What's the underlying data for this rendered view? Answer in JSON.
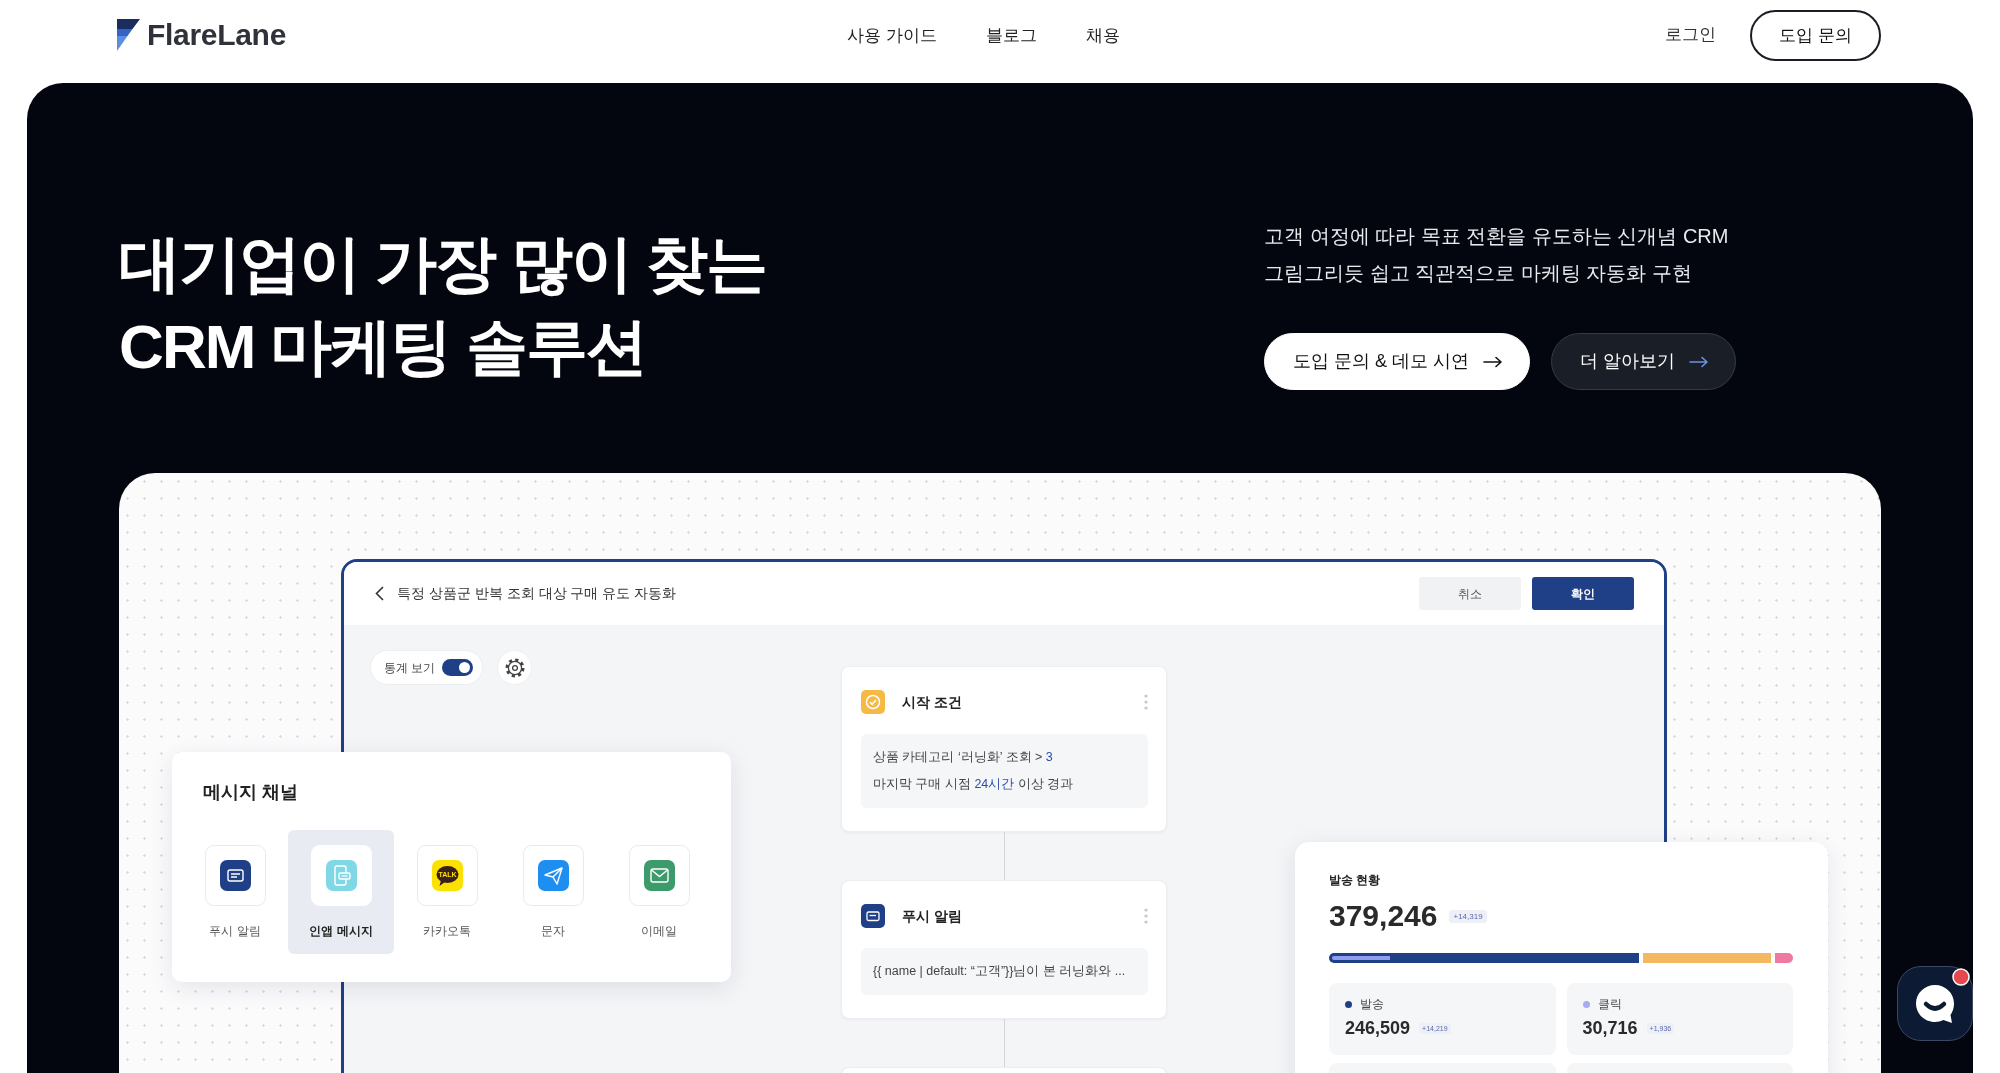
{
  "header": {
    "logo": "FlareLane",
    "nav": [
      "사용 가이드",
      "블로그",
      "채용"
    ],
    "login": "로그인",
    "cta": "도입 문의"
  },
  "hero": {
    "headline": [
      "대기업이 가장 많이 찾는",
      "CRM 마케팅 솔루션"
    ],
    "description": [
      "고객 여정에 따라 목표 전환을 유도하는 신개념 CRM",
      "그림그리듯 쉽고 직관적으로 마케팅 자동화 구현"
    ],
    "buttons": [
      {
        "label": "도입 문의 & 데모 시연",
        "kind": "primary"
      },
      {
        "label": "더 알아보기",
        "kind": "secondary"
      }
    ]
  },
  "editor": {
    "title": "특정 상품군 반복 조회 대상 구매 유도 자동화",
    "actions": [
      {
        "label": "취소",
        "kind": "secondary"
      },
      {
        "label": "확인",
        "kind": "primary"
      }
    ],
    "stats_toggle": {
      "label": "통계 보기",
      "on": true
    },
    "nodes": [
      {
        "kind": "trigger",
        "title": "시작 조건",
        "lines": [
          [
            {
              "text": "상품 카테고리 ‘러닝화’ 조회 > ",
              "highlight": false
            },
            {
              "text": "3",
              "highlight": true
            }
          ],
          [
            {
              "text": "마지막 구매 시점 ",
              "highlight": false
            },
            {
              "text": "24시간",
              "highlight": true
            },
            {
              "text": " 이상 경과",
              "highlight": false
            }
          ]
        ]
      },
      {
        "kind": "push",
        "title": "푸시 알림",
        "lines": [
          [
            {
              "text": "{{ name | default: “고객”}}님이 본 러닝화와 ...",
              "highlight": false
            }
          ]
        ]
      },
      {
        "kind": "cut_off"
      }
    ]
  },
  "channels": {
    "title": "메시지 채널",
    "items": [
      {
        "kind": "push",
        "label": "푸시 알림",
        "selected": false
      },
      {
        "kind": "in_app",
        "label": "인앱 메시지",
        "selected": true
      },
      {
        "kind": "kakao",
        "label": "카카오톡",
        "icon_text": "TALK",
        "selected": false
      },
      {
        "kind": "sms",
        "label": "문자",
        "selected": false
      },
      {
        "kind": "email",
        "label": "이메일",
        "selected": false
      }
    ]
  },
  "stats": {
    "title": "발송 현황",
    "total": "379,246",
    "change": "+14,319",
    "metrics": [
      {
        "kind": "metric",
        "label": "발송",
        "value": "246,509",
        "change": "+14,219",
        "color": "#1f3f87"
      },
      {
        "kind": "metric",
        "label": "클릭",
        "value": "30,716",
        "change": "+1,936",
        "color": "#a9abf0"
      },
      {
        "kind": "cut_off"
      },
      {
        "kind": "cut_off"
      }
    ]
  },
  "chat_launcher": {
    "unread": true
  }
}
